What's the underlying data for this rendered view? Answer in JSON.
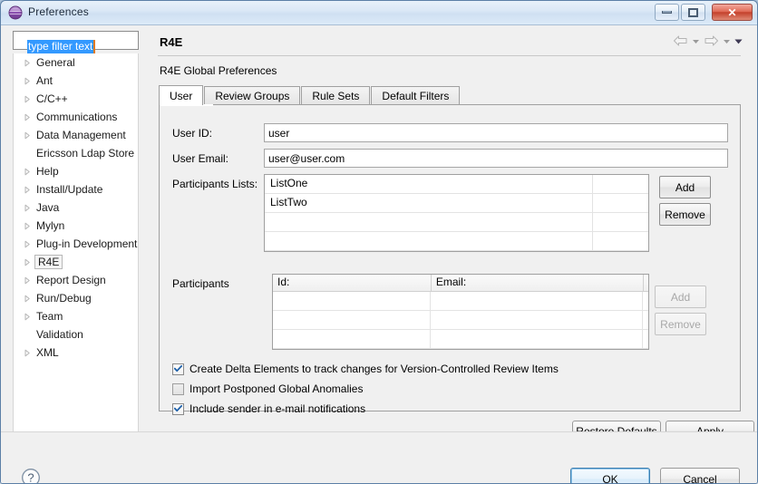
{
  "window": {
    "title": "Preferences",
    "icon": "preferences-sphere-icon",
    "controls": {
      "minimize": "minimize-icon",
      "maximize": "maximize-icon",
      "close": "✕"
    }
  },
  "sidebar": {
    "filter": {
      "value": "type filter text",
      "placeholder": "type filter text"
    },
    "items": [
      {
        "label": "General",
        "expandable": true,
        "selected": false
      },
      {
        "label": "Ant",
        "expandable": true,
        "selected": false
      },
      {
        "label": "C/C++",
        "expandable": true,
        "selected": false
      },
      {
        "label": "Communications",
        "expandable": true,
        "selected": false
      },
      {
        "label": "Data Management",
        "expandable": true,
        "selected": false
      },
      {
        "label": "Ericsson Ldap Store",
        "expandable": false,
        "selected": false
      },
      {
        "label": "Help",
        "expandable": true,
        "selected": false
      },
      {
        "label": "Install/Update",
        "expandable": true,
        "selected": false
      },
      {
        "label": "Java",
        "expandable": true,
        "selected": false
      },
      {
        "label": "Mylyn",
        "expandable": true,
        "selected": false
      },
      {
        "label": "Plug-in Development",
        "expandable": true,
        "selected": false
      },
      {
        "label": "R4E",
        "expandable": true,
        "selected": true
      },
      {
        "label": "Report Design",
        "expandable": true,
        "selected": false
      },
      {
        "label": "Run/Debug",
        "expandable": true,
        "selected": false
      },
      {
        "label": "Team",
        "expandable": true,
        "selected": false
      },
      {
        "label": "Validation",
        "expandable": false,
        "selected": false
      },
      {
        "label": "XML",
        "expandable": true,
        "selected": false
      }
    ]
  },
  "page": {
    "title": "R4E",
    "subtitle": "R4E Global Preferences",
    "nav": {
      "back": "back-arrow-icon",
      "back_menu": "chevron-down-icon",
      "forward": "forward-arrow-icon",
      "forward_menu": "chevron-down-icon",
      "view_menu": "view-menu-icon"
    },
    "tabs": [
      {
        "label": "User",
        "active": true
      },
      {
        "label": "Review Groups",
        "active": false
      },
      {
        "label": "Rule Sets",
        "active": false
      },
      {
        "label": "Default Filters",
        "active": false
      }
    ]
  },
  "form": {
    "user_id": {
      "label": "User ID:",
      "value": "user"
    },
    "user_email": {
      "label": "User Email:",
      "value": "user@user.com"
    },
    "participants_lists": {
      "label": "Participants Lists:",
      "rows": [
        "ListOne",
        "ListTwo",
        "",
        ""
      ],
      "add_label": "Add",
      "remove_label": "Remove",
      "add_enabled": true,
      "remove_enabled": true
    },
    "participants": {
      "label": "Participants",
      "columns": [
        "Id:",
        "Email:",
        ""
      ],
      "rows": [
        [
          "",
          "",
          ""
        ],
        [
          "",
          "",
          ""
        ],
        [
          "",
          "",
          ""
        ]
      ],
      "add_label": "Add",
      "remove_label": "Remove",
      "add_enabled": false,
      "remove_enabled": false
    },
    "checkboxes": [
      {
        "label": "Create Delta Elements to track changes for Version-Controlled Review Items",
        "checked": true
      },
      {
        "label": "Import Postponed Global Anomalies",
        "checked": false
      },
      {
        "label": "Include sender in e-mail notifications",
        "checked": true
      }
    ]
  },
  "actions": {
    "restore_defaults": "Restore Defaults",
    "restore_defaults_mnemonic": "D",
    "apply": "Apply",
    "apply_mnemonic": "A",
    "ok": "OK",
    "cancel": "Cancel",
    "help": "help-icon"
  },
  "colors": {
    "selection_blue": "#3399ff",
    "cursor_orange": "#e07a1f",
    "close_red": "#c4412c",
    "focus_blue": "#3c7fb1"
  }
}
